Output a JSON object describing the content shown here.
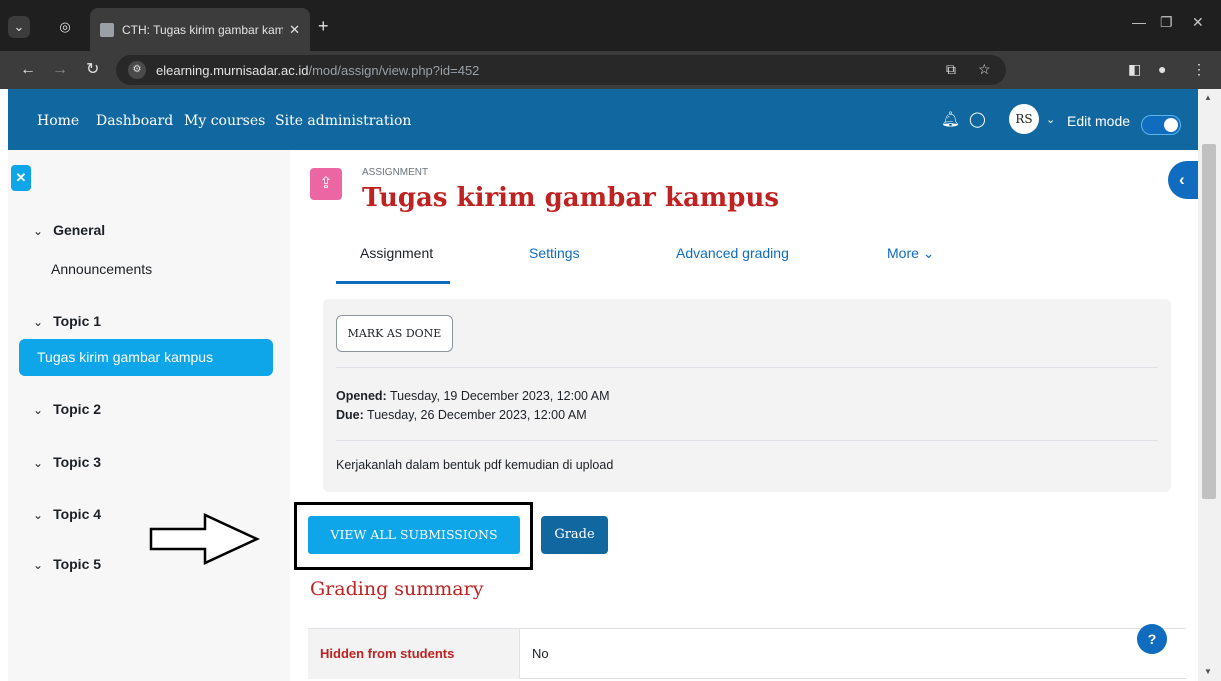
{
  "browser": {
    "tab_title": "CTH: Tugas kirim gambar kamp",
    "url_host": "elearning.murnisadar.ac.id",
    "url_path": "/mod/assign/view.php?id=452"
  },
  "navbar": {
    "items": [
      "Home",
      "Dashboard",
      "My courses",
      "Site administration"
    ],
    "avatar_initials": "RS",
    "edit_mode_label": "Edit mode"
  },
  "drawer": {
    "sections": [
      {
        "label": "General"
      },
      {
        "label": "Topic 1"
      },
      {
        "label": "Topic 2"
      },
      {
        "label": "Topic 3"
      },
      {
        "label": "Topic 4"
      },
      {
        "label": "Topic 5"
      }
    ],
    "general_item": "Announcements",
    "topic1_item": "Tugas kirim gambar kampus"
  },
  "header": {
    "activity_type": "ASSIGNMENT",
    "title": "Tugas kirim gambar kampus"
  },
  "tabs": [
    "Assignment",
    "Settings",
    "Advanced grading",
    "More ⌄"
  ],
  "panel": {
    "mark_done_label": "MARK AS DONE",
    "opened_label": "Opened:",
    "opened_value": " Tuesday, 19 December 2023, 12:00 AM",
    "due_label": "Due:",
    "due_value": " Tuesday, 26 December 2023, 12:00 AM",
    "description": "Kerjakanlah dalam bentuk pdf kemudian di upload"
  },
  "actions": {
    "view_all_label": "VIEW ALL SUBMISSIONS",
    "grade_label": "Grade"
  },
  "grading_summary": {
    "heading": "Grading summary",
    "rows": [
      {
        "label": "Hidden from students",
        "value": "No"
      }
    ]
  },
  "colors": {
    "navbar": "#1168a0",
    "accent": "#0ea5e9",
    "title_red": "#c02121",
    "assignment_icon": "#eb66a2"
  }
}
